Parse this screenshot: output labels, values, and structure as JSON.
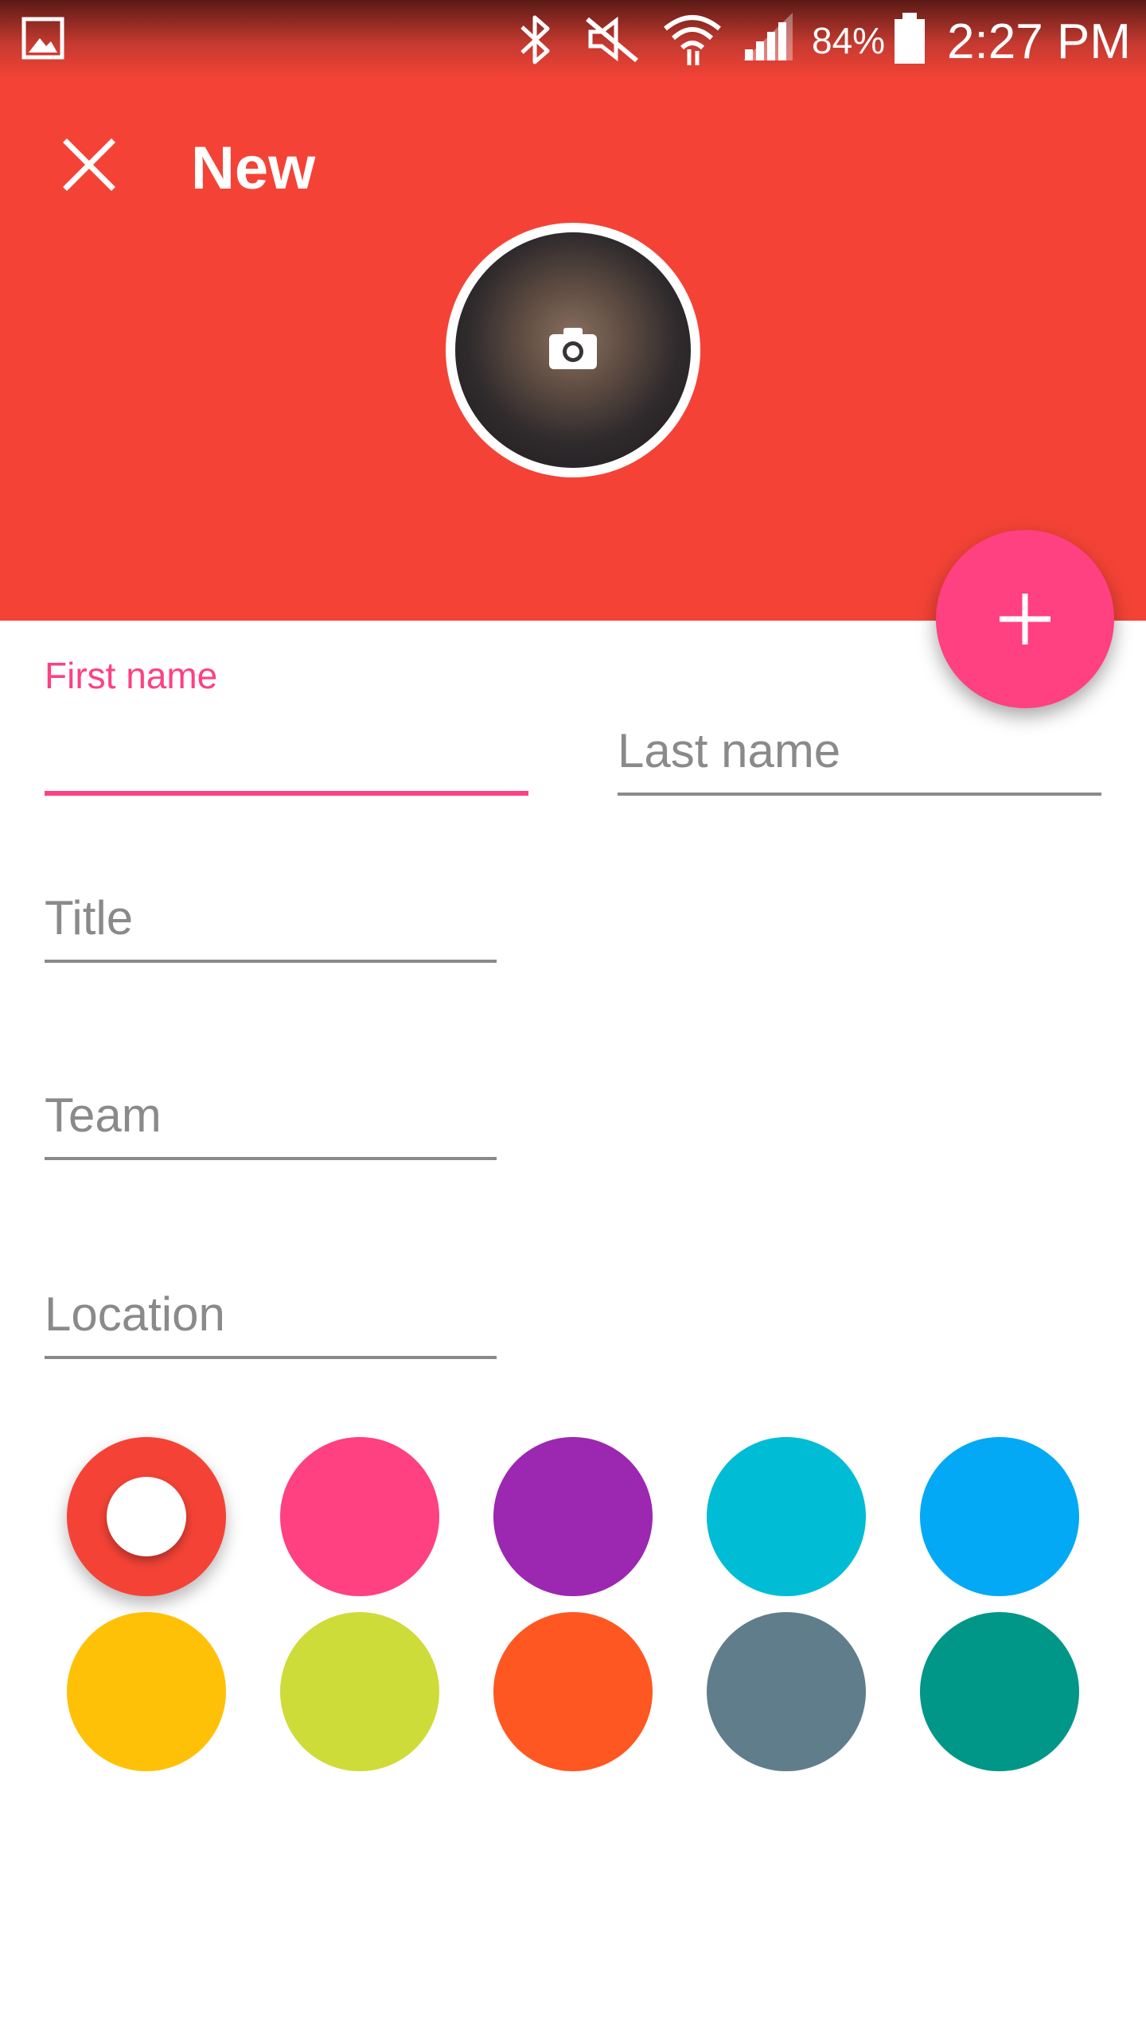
{
  "status_bar": {
    "battery": "84%",
    "time": "2:27 PM",
    "icons": [
      "gallery-icon",
      "bluetooth-icon",
      "mute-icon",
      "wifi-icon",
      "signal-icon",
      "battery-icon"
    ]
  },
  "toolbar": {
    "title": "New",
    "close_icon": "close-icon"
  },
  "avatar": {
    "icon": "camera-icon"
  },
  "fab": {
    "icon": "plus-icon"
  },
  "form": {
    "first_name": {
      "label": "First name",
      "value": ""
    },
    "last_name": {
      "placeholder": "Last name",
      "value": ""
    },
    "title": {
      "placeholder": "Title",
      "value": ""
    },
    "team": {
      "placeholder": "Team",
      "value": ""
    },
    "location": {
      "placeholder": "Location",
      "value": ""
    }
  },
  "colors": {
    "header": "#f44336",
    "accent": "#ff4081",
    "selected_swatch": "#f44336",
    "swatches": [
      "#f44336",
      "#ff4081",
      "#9c27b0",
      "#00bcd4",
      "#03a9f4",
      "#ffc107",
      "#cddc39",
      "#ff5722",
      "#607d8b",
      "#009688"
    ]
  }
}
